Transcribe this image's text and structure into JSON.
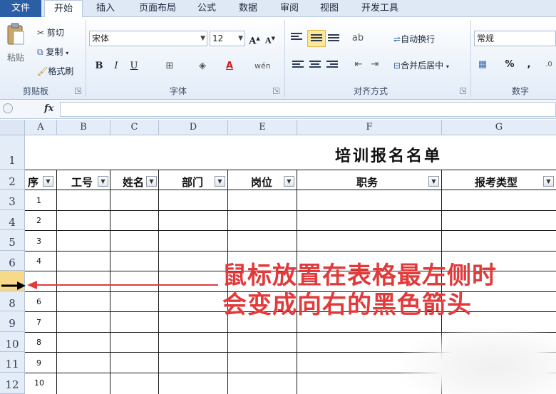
{
  "tabs": {
    "file": "文件",
    "home": "开始",
    "insert": "插入",
    "layout": "页面布局",
    "formulas": "公式",
    "data": "数据",
    "review": "审阅",
    "view": "视图",
    "developer": "开发工具"
  },
  "ribbon": {
    "clipboard": {
      "paste": "粘贴",
      "cut": "剪切",
      "copy": "复制",
      "painter": "格式刷",
      "label": "剪贴板"
    },
    "font": {
      "name": "宋体",
      "size": "12",
      "bold": "B",
      "italic": "I",
      "underline": "U",
      "grow": "A",
      "shrink": "A",
      "label": "字体"
    },
    "align": {
      "wrap": "自动换行",
      "merge": "合并后居中",
      "label": "对齐方式"
    },
    "number": {
      "format": "常规",
      "percent": "%",
      "comma": ",",
      "label": "数字"
    }
  },
  "formula_bar": {
    "fx": "fx",
    "value": ""
  },
  "columns": [
    "A",
    "B",
    "C",
    "D",
    "E",
    "F",
    "G"
  ],
  "rows": [
    "1",
    "2",
    "3",
    "4",
    "5",
    "6",
    "7",
    "8",
    "9",
    "10",
    "11",
    "12"
  ],
  "sheet": {
    "title": "培训报名名单",
    "headers": [
      "序号",
      "工号",
      "姓名",
      "部门",
      "岗位",
      "职务",
      "报考类型"
    ],
    "header_a_visible": "序",
    "serials": [
      "1",
      "2",
      "3",
      "4",
      "",
      "6",
      "7",
      "8",
      "9",
      "10"
    ]
  },
  "annotation": {
    "line1": "鼠标放置在表格最左侧时",
    "line2": "会变成向右的黑色箭头"
  },
  "colors": {
    "accent": "#2a5fa6",
    "annotation": "#e23a3a",
    "selected_row": "#f7d98a"
  }
}
